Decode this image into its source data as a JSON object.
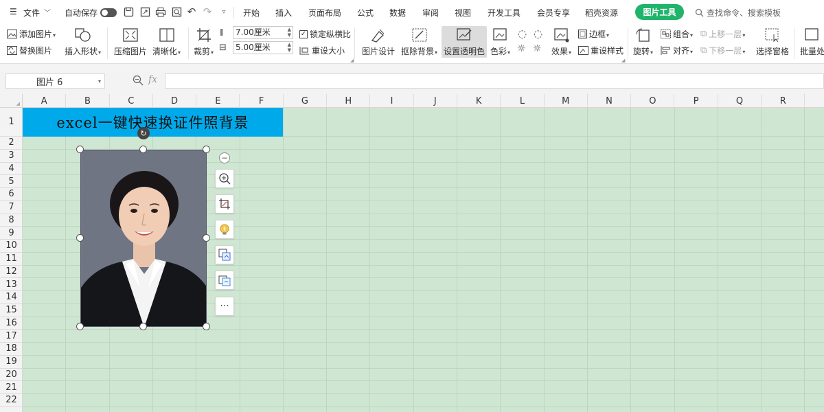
{
  "menubar": {
    "file": "文件",
    "autosave": "自动保存",
    "tabs": [
      "开始",
      "插入",
      "页面布局",
      "公式",
      "数据",
      "审阅",
      "视图",
      "开发工具",
      "会员专享",
      "稻壳资源"
    ],
    "picture_tools": "图片工具",
    "search_placeholder": "查找命令、搜索模板"
  },
  "ribbon": {
    "add_picture": "添加图片",
    "replace_picture": "替换图片",
    "insert_shape": "插入形状",
    "compress_picture": "压缩图片",
    "sharpen": "清晰化",
    "crop": "裁剪",
    "width_value": "7.00厘米",
    "height_value": "5.00厘米",
    "lock_ratio": "锁定纵横比",
    "reset_size": "重设大小",
    "picture_design": "图片设计",
    "remove_bg": "抠除背景",
    "set_transparent": "设置透明色",
    "color": "色彩",
    "effects": "效果",
    "border": "边框",
    "reset_style": "重设样式",
    "rotate": "旋转",
    "group": "组合",
    "align": "对齐",
    "bring_forward": "上移一层",
    "send_backward": "下移一层",
    "selection_pane": "选择窗格",
    "batch": "批量处"
  },
  "formula_bar": {
    "name_box": "图片 6",
    "fx": "fx",
    "value": ""
  },
  "sheet": {
    "columns": [
      "A",
      "B",
      "C",
      "D",
      "E",
      "F",
      "G",
      "H",
      "I",
      "J",
      "K",
      "L",
      "M",
      "N",
      "O",
      "P",
      "Q",
      "R"
    ],
    "rows": [
      "1",
      "2",
      "3",
      "4",
      "5",
      "6",
      "7",
      "8",
      "9",
      "10",
      "11",
      "12",
      "13",
      "14",
      "15",
      "16",
      "17",
      "18",
      "19",
      "20",
      "21",
      "22"
    ],
    "title_cell": "excel一键快速换证件照背景",
    "title_fill": "#00aaea",
    "grid_fill": "#cfe7d2"
  },
  "colors": {
    "accent_green": "#1fb469",
    "photo_bg": "#6f7582"
  },
  "picture": {
    "description_icons": [
      "zoom-in-icon",
      "crop-icon",
      "bulb-icon",
      "convert-icon",
      "image-translate-icon",
      "more-icon"
    ],
    "more": "···"
  }
}
